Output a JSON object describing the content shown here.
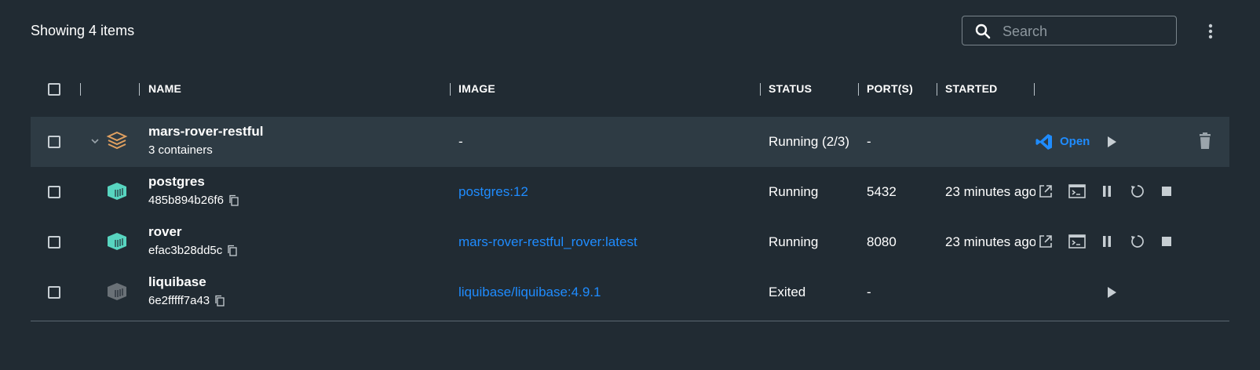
{
  "toolbar": {
    "showing": "Showing 4 items",
    "search_placeholder": "Search"
  },
  "columns": {
    "name": "NAME",
    "image": "IMAGE",
    "status": "STATUS",
    "ports": "PORT(S)",
    "started": "STARTED"
  },
  "group": {
    "name": "mars-rover-restful",
    "sub": "3 containers",
    "image": "-",
    "status": "Running (2/3)",
    "port": "-",
    "open_label": "Open"
  },
  "containers": [
    {
      "name": "postgres",
      "id": "485b894b26f6",
      "image": "postgres:12",
      "status": "Running",
      "port": "5432",
      "started": "23 minutes ago",
      "icon_color": "#58d5c0"
    },
    {
      "name": "rover",
      "id": "efac3b28dd5c",
      "image": "mars-rover-restful_rover:latest",
      "status": "Running",
      "port": "8080",
      "started": "23 minutes ago",
      "icon_color": "#58d5c0"
    },
    {
      "name": "liquibase",
      "id": "6e2fffff7a43",
      "image": "liquibase/liquibase:4.9.1",
      "status": "Exited",
      "port": "-",
      "started": "",
      "icon_color": "#6a7177"
    }
  ],
  "colors": {
    "background": "#212b33",
    "group_row": "#2e3b44",
    "link": "#1f8cff",
    "running_icon": "#58d5c0",
    "exited_icon": "#6a7177",
    "compose_icon": "#e0a060"
  },
  "icons": [
    "search-icon",
    "kebab-menu-icon",
    "chevron-down-icon",
    "compose-stack-icon",
    "vscode-icon",
    "play-icon",
    "trash-icon",
    "container-icon",
    "copy-icon",
    "external-link-icon",
    "terminal-icon",
    "pause-icon",
    "restart-icon",
    "stop-icon"
  ]
}
